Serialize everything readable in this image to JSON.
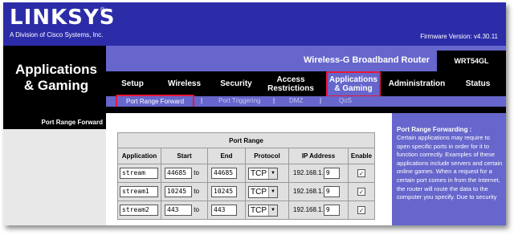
{
  "header": {
    "logo": "LINKSYS",
    "logo_mark": "®",
    "subtitle": "A Division of Cisco Systems, Inc.",
    "firmware": "Firmware Version: v4.30.11"
  },
  "page_title": "Applications & Gaming",
  "product_name": "Wireless-G Broadband Router",
  "model": "WRT54GL",
  "nav": {
    "tabs": [
      {
        "label": "Setup"
      },
      {
        "label": "Wireless"
      },
      {
        "label": "Security"
      },
      {
        "label": "Access Restrictions"
      },
      {
        "label": "Applications & Gaming"
      },
      {
        "label": "Administration"
      },
      {
        "label": "Status"
      }
    ],
    "active_index": 4
  },
  "subnav": {
    "items": [
      "Port Range Forward",
      "Port Triggering",
      "DMZ",
      "QoS"
    ],
    "separator": "|",
    "active_index": 0
  },
  "left_section": "Port Range Forward",
  "table": {
    "title": "Port Range",
    "headers": [
      "Application",
      "Start",
      "End",
      "Protocol",
      "IP Address",
      "Enable"
    ],
    "to_label": "to",
    "ip_prefix": "192.168.1.",
    "rows": [
      {
        "application": "stream",
        "start": "44685",
        "end": "44685",
        "protocol": "TCP",
        "ip_last": "9",
        "enabled": true
      },
      {
        "application": "stream1",
        "start": "10245",
        "end": "10245",
        "protocol": "TCP",
        "ip_last": "9",
        "enabled": true
      },
      {
        "application": "stream2",
        "start": "443",
        "end": "443",
        "protocol": "TCP",
        "ip_last": "9",
        "enabled": true
      }
    ]
  },
  "help": {
    "title": "Port Range Forwarding :",
    "body": "Certain applications may require to open specific ports in order for it to function correctly. Examples of these applications include servers and certain online games. When a request for a certain port comes in from the Internet, the router will route the data to the computer you specify. Due to security"
  },
  "colors": {
    "brand_blue": "#2c2ca8",
    "accent_purple": "#6666cc",
    "highlight_red": "#e8173a"
  }
}
